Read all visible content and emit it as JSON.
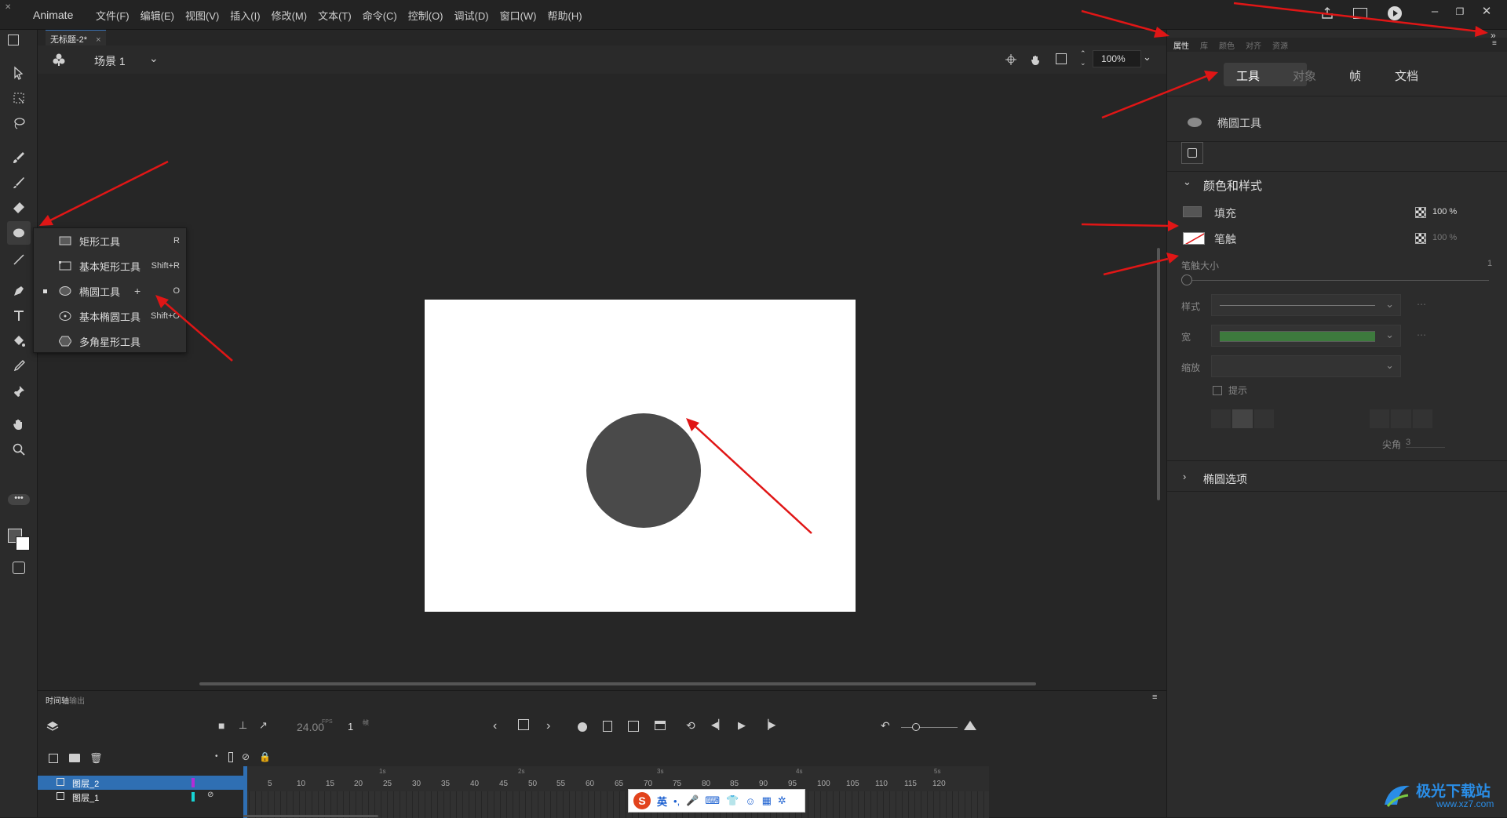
{
  "app": {
    "name": "Animate"
  },
  "menu": [
    "文件(F)",
    "编辑(E)",
    "视图(V)",
    "插入(I)",
    "修改(M)",
    "文本(T)",
    "命令(C)",
    "控制(O)",
    "调试(D)",
    "窗口(W)",
    "帮助(H)"
  ],
  "document": {
    "tab_title": "无标题-2*",
    "scene": "场景 1",
    "zoom": "100%"
  },
  "tool_menu": {
    "items": [
      {
        "label": "矩形工具",
        "shortcut": "R",
        "icon": "rectangle-icon",
        "selected": false
      },
      {
        "label": "基本矩形工具",
        "shortcut": "Shift+R",
        "icon": "primitive-rectangle-icon",
        "selected": false
      },
      {
        "label": "椭圆工具",
        "shortcut": "O",
        "icon": "ellipse-icon",
        "selected": true
      },
      {
        "label": "基本椭圆工具",
        "shortcut": "Shift+O",
        "icon": "primitive-ellipse-icon",
        "selected": false
      },
      {
        "label": "多角星形工具",
        "shortcut": "",
        "icon": "polystar-icon",
        "selected": false
      }
    ]
  },
  "right_panel": {
    "top_tabs": [
      "属性",
      "库",
      "颜色",
      "对齐",
      "资源"
    ],
    "sub_tabs": [
      "工具",
      "对象",
      "帧",
      "文档"
    ],
    "active_sub_tab": "工具",
    "tool_name": "椭圆工具",
    "section_color": "颜色和样式",
    "fill": {
      "label": "填充",
      "opacity": "100 %"
    },
    "stroke": {
      "label": "笔触",
      "opacity": "100 %"
    },
    "stroke_size": {
      "label": "笔触大小",
      "value": "1"
    },
    "style_label": "样式",
    "width_label": "宽",
    "scale_label": "缩放",
    "hint_label": "提示",
    "miter": {
      "label": "尖角",
      "value": "3"
    },
    "section_ellipse": "椭圆选项"
  },
  "timeline": {
    "tabs": [
      "时间轴",
      "输出"
    ],
    "fps": "24.00",
    "fps_unit": "FPS",
    "frame": "1",
    "frame_unit": "帧",
    "seconds": [
      "1s",
      "2s",
      "3s",
      "4s",
      "5s"
    ],
    "frame_ticks": [
      "5",
      "10",
      "15",
      "20",
      "25",
      "30",
      "35",
      "40",
      "45",
      "50",
      "55",
      "60",
      "65",
      "70",
      "75",
      "80",
      "85",
      "90",
      "95",
      "100",
      "105",
      "110",
      "115",
      "120"
    ],
    "layers": [
      {
        "name": "图层_2",
        "color": "#b32cd6",
        "selected": true
      },
      {
        "name": "图层_1",
        "color": "#17d4d4",
        "selected": false
      }
    ]
  },
  "ime_bar": {
    "lang": "英"
  },
  "watermark": {
    "text": "极光下载站",
    "url": "www.xz7.com"
  },
  "colors": {
    "accent": "#2f6fb3",
    "stage_shape": "#4a4a4a",
    "annotation": "#e01616"
  }
}
